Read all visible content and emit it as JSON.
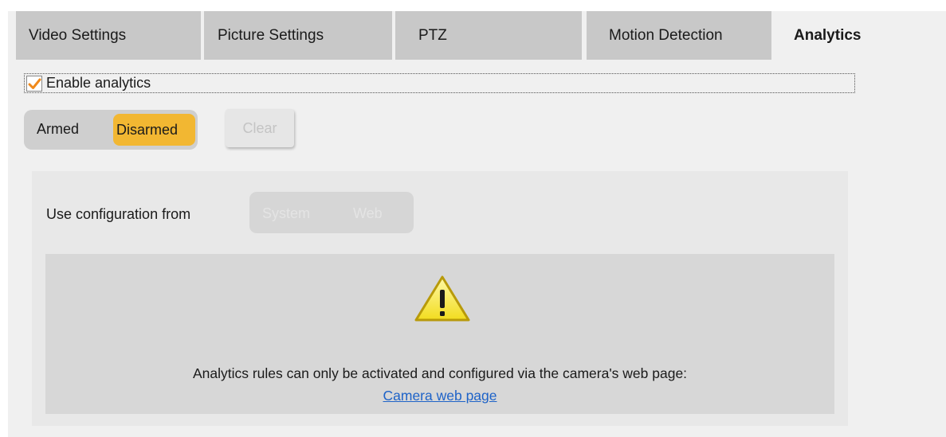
{
  "tabs": [
    {
      "label": "Video Settings",
      "active": false
    },
    {
      "label": "Picture Settings",
      "active": false
    },
    {
      "label": "PTZ",
      "active": false
    },
    {
      "label": "Motion Detection",
      "active": false
    },
    {
      "label": "Analytics",
      "active": true
    }
  ],
  "enable_analytics": {
    "label": "Enable analytics",
    "checked": true
  },
  "arm_state": {
    "armed_label": "Armed",
    "disarmed_label": "Disarmed",
    "selected": "Disarmed"
  },
  "clear_label": "Clear",
  "config": {
    "label": "Use configuration from",
    "options": [
      "System",
      "Web"
    ]
  },
  "warning": {
    "icon": "warning-icon",
    "message": "Analytics rules can only be activated and configured via the camera's web page:",
    "link_text": "Camera web page"
  },
  "colors": {
    "tab_inactive": "#c8c8c8",
    "panel_bg": "#f0f0f0",
    "selected_accent": "#f2b732",
    "link": "#1e63c8",
    "checkmark": "#f08a1c"
  }
}
